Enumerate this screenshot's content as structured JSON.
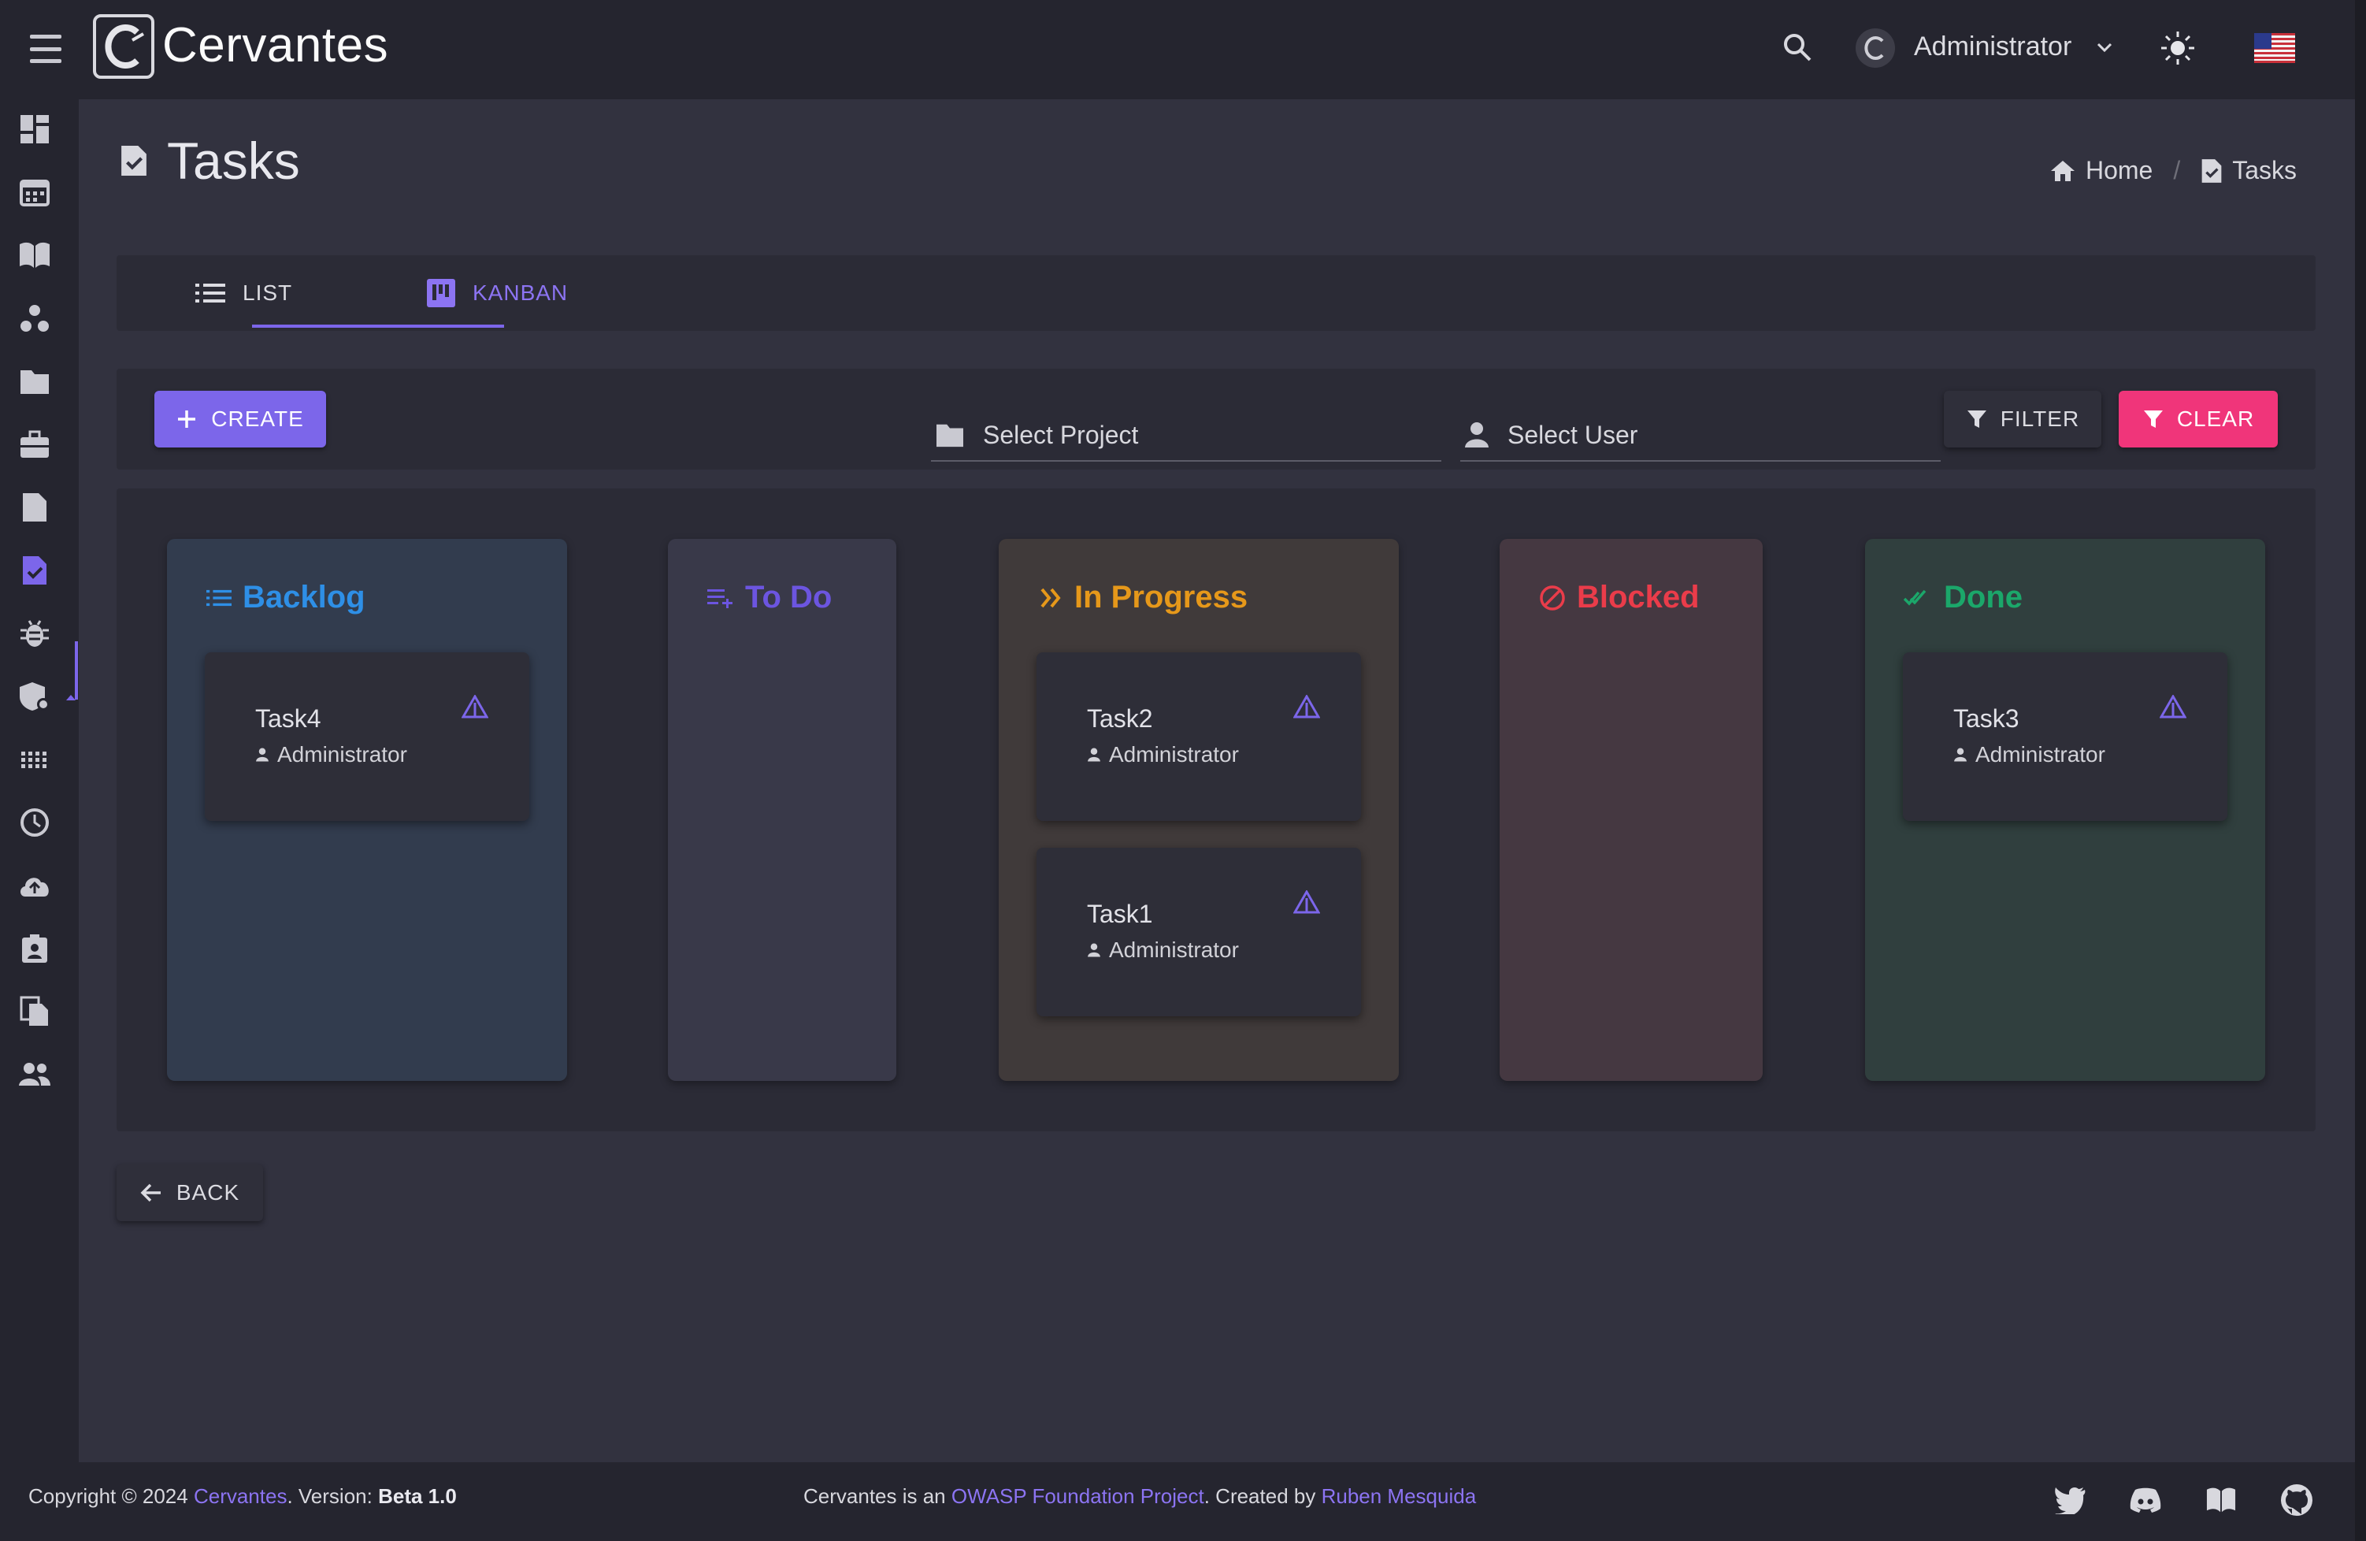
{
  "app": {
    "brand": "Cervantes"
  },
  "topbar": {
    "user_name": "Administrator"
  },
  "page": {
    "title": "Tasks"
  },
  "breadcrumb": {
    "home": "Home",
    "current": "Tasks",
    "separator": "/"
  },
  "tabs": [
    {
      "label": "LIST",
      "active": false
    },
    {
      "label": "KANBAN",
      "active": true
    }
  ],
  "filters": {
    "create_label": "CREATE",
    "project_placeholder": "Select Project",
    "user_placeholder": "Select User",
    "filter_label": "FILTER",
    "clear_label": "CLEAR"
  },
  "columns": [
    {
      "title": "Backlog",
      "color": "#2e8fe6",
      "icon": "list-icon",
      "tasks": [
        {
          "name": "Task4",
          "user": "Administrator"
        }
      ]
    },
    {
      "title": "To Do",
      "color": "#6c55e0",
      "icon": "playlist-add-icon",
      "tasks": []
    },
    {
      "title": "In Progress",
      "color": "#e6981a",
      "icon": "double-chevron-icon",
      "tasks": [
        {
          "name": "Task2",
          "user": "Administrator"
        },
        {
          "name": "Task1",
          "user": "Administrator"
        }
      ]
    },
    {
      "title": "Blocked",
      "color": "#ea3c4a",
      "icon": "block-icon",
      "tasks": []
    },
    {
      "title": "Done",
      "color": "#1ba76a",
      "icon": "done-all-icon",
      "tasks": [
        {
          "name": "Task3",
          "user": "Administrator"
        }
      ]
    }
  ],
  "back_label": "BACK",
  "footer": {
    "copyright_prefix": "Copyright © 2024",
    "brand_link": "Cervantes",
    "version_prefix": ". Version:",
    "version": "Beta 1.0",
    "mid_prefix": "Cervantes is an",
    "owasp_link": "OWASP Foundation Project",
    "created_by": ". Created by",
    "author_link": "Ruben Mesquida"
  },
  "colors": {
    "accent": "#7c66ea",
    "clear": "#f0357a",
    "bg": "#32323f",
    "bar": "#25252f"
  }
}
